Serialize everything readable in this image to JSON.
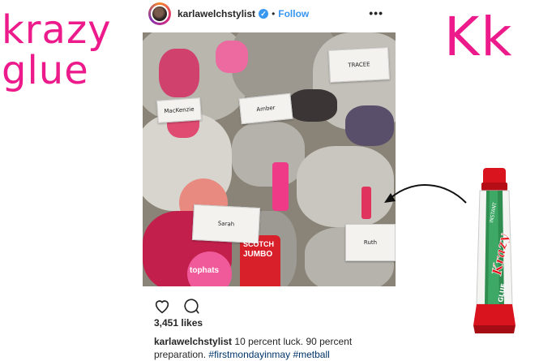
{
  "brand": {
    "line1": "krazy",
    "line2": "glue",
    "initials": "Kk",
    "accent_color": "#ec1a8b"
  },
  "post": {
    "username": "karlawelchstylist",
    "verified_icon": "verified-badge-icon",
    "separator": "•",
    "follow_label": "Follow",
    "more_icon": "more-options-icon",
    "more_label": "•••",
    "photo_tags": [
      "MacKenzie",
      "Amber",
      "TRACEE",
      "Sarah",
      "Ruth"
    ],
    "photo_labels": [
      "tophats",
      "SCOTCH",
      "JUMBO"
    ],
    "like_icon": "heart-icon",
    "comment_icon": "comment-icon",
    "likes": "3,451 likes",
    "caption_user": "karlawelchstylist",
    "caption_text": " 10 percent luck. 90 percent preparation. ",
    "hashtag1": "#firstmondayinmay",
    "hashtag2": "#metball"
  },
  "product": {
    "label_top": "INSTANT",
    "label_brand": "Krazy",
    "label_bottom": "GLUE"
  }
}
